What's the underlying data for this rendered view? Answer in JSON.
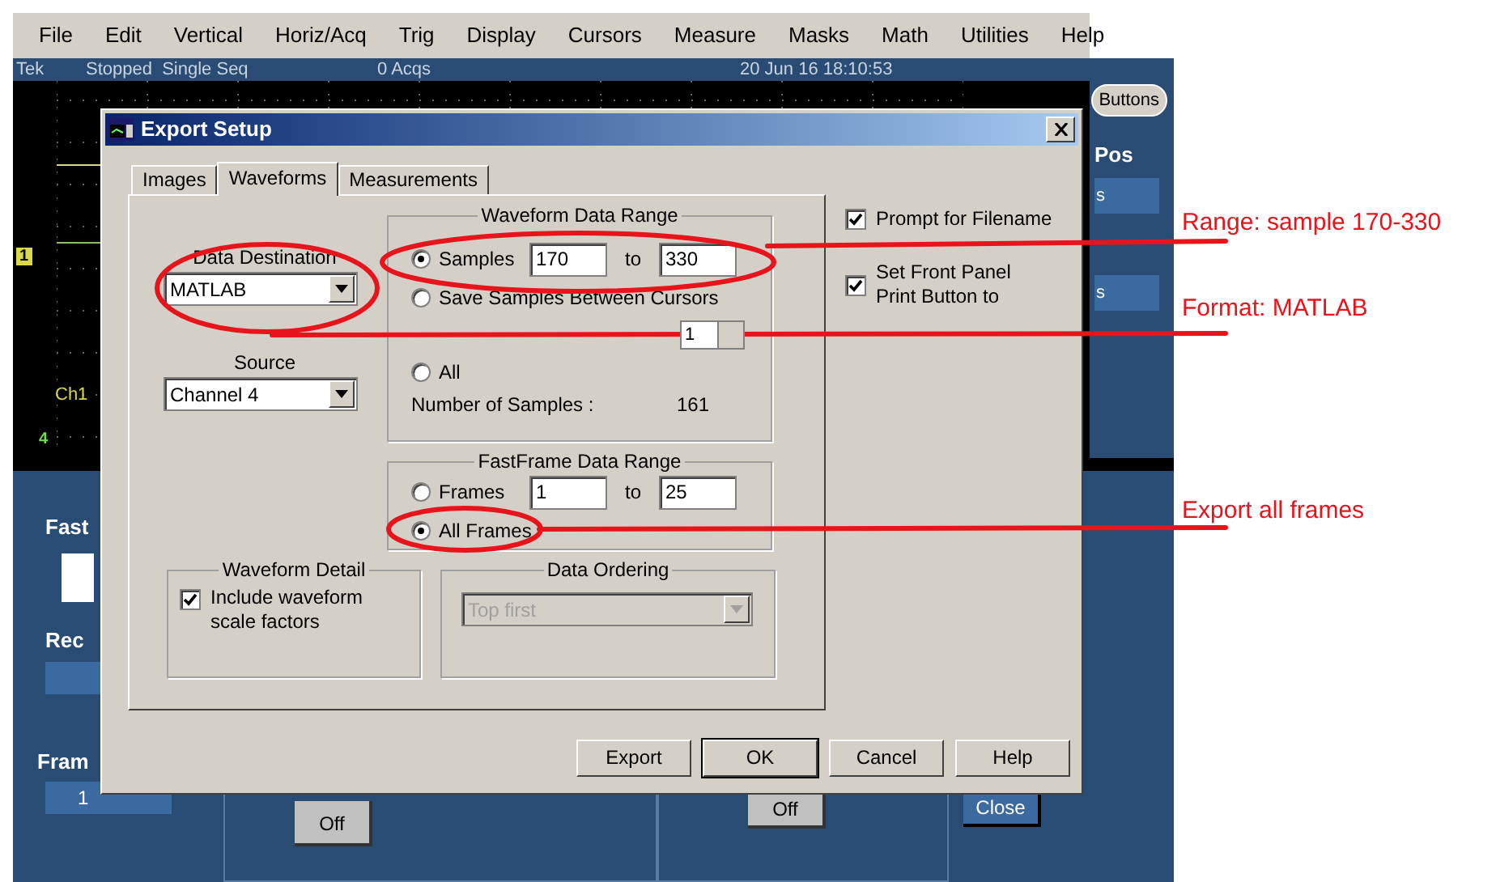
{
  "menu": [
    "File",
    "Edit",
    "Vertical",
    "Horiz/Acq",
    "Trig",
    "Display",
    "Cursors",
    "Measure",
    "Masks",
    "Math",
    "Utilities",
    "Help"
  ],
  "status_bar": {
    "brand": "Tek",
    "state": "Stopped  Single Seq",
    "acquisitions": "0 Acqs",
    "timestamp": "20 Jun 16 18:10:53"
  },
  "scope": {
    "trigger_marker": "1",
    "channel_label": "Ch1",
    "channel_marker": "4"
  },
  "side_panel": {
    "button": "Buttons",
    "heading": "Pos",
    "fields": [
      "s",
      "s"
    ]
  },
  "bottom_panel": {
    "labels": [
      "Fast",
      "Rec",
      "Fram"
    ],
    "frame_value": "1",
    "buttons": [
      "Off",
      "Off"
    ],
    "close": "Close"
  },
  "dialog": {
    "title": "Export Setup",
    "tabs": [
      {
        "label": "Images",
        "selected": false
      },
      {
        "label": "Waveforms",
        "selected": true
      },
      {
        "label": "Measurements",
        "selected": false
      }
    ],
    "destination": {
      "label": "Data Destination",
      "value": "MATLAB"
    },
    "source": {
      "label": "Source",
      "value": "Channel 4"
    },
    "waveform_range": {
      "title": "Waveform Data Range",
      "options": [
        {
          "kind": "range",
          "label": "Samples",
          "selected": true,
          "from": "170",
          "to_label": "to",
          "to": "330"
        },
        {
          "kind": "radio",
          "label": "Save Samples Between Cursors",
          "selected": false
        },
        {
          "kind": "spin",
          "value": "1"
        },
        {
          "kind": "radio",
          "label": "All",
          "selected": false
        }
      ],
      "count_label": "Number of Samples :",
      "count": "161"
    },
    "fastframe_range": {
      "title": "FastFrame Data Range",
      "options": [
        {
          "kind": "range",
          "label": "Frames",
          "selected": false,
          "from": "1",
          "to_label": "to",
          "to": "25"
        },
        {
          "kind": "radio",
          "label": "All Frames",
          "selected": true
        }
      ]
    },
    "waveform_detail": {
      "title": "Waveform Detail",
      "label": "Include waveform scale factors",
      "checked": true
    },
    "data_ordering": {
      "title": "Data Ordering",
      "value": "Top first",
      "disabled": true
    },
    "options": [
      {
        "label": "Prompt for Filename",
        "checked": true
      },
      {
        "label": "Set Front Panel Print Button to",
        "checked": true
      }
    ],
    "buttons": [
      {
        "label": "Export",
        "default": false
      },
      {
        "label": "OK",
        "default": true
      },
      {
        "label": "Cancel",
        "default": false
      },
      {
        "label": "Help",
        "default": false
      }
    ]
  },
  "annotations": [
    {
      "label": "Range: sample 170-330"
    },
    {
      "label": "Format: MATLAB"
    },
    {
      "label": "Export all frames"
    }
  ]
}
